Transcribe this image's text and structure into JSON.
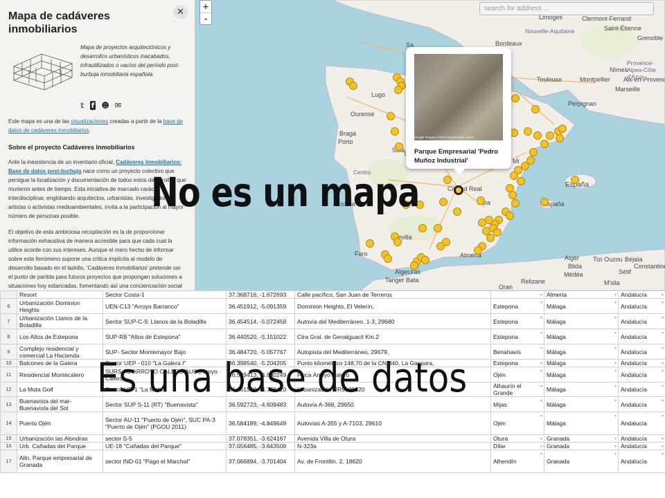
{
  "sidebar": {
    "title": "Mapa de cadáveres inmobiliarios",
    "close": "✕",
    "tagline": "Mapa de proyectos arquitectónicos y desarrollos urbanísticos inacabados, infrautilizados o vacíos del período post-burbuja inmobiliaria española.",
    "social_icons": [
      "twitter-icon",
      "facebook-icon",
      "github-icon",
      "mail-icon"
    ],
    "p1_a": "Este mapa es una de las ",
    "p1_link1": "visualizaciones",
    "p1_b": " creadas a partir de la ",
    "p1_link2": "base de datos de cadáveres inmobiliarios",
    "p1_c": ".",
    "section_title": "Sobre el proyecto Cadáveres Inmobiliarios",
    "p2_a": "Ante la inexistencia de un inventario oficial, ",
    "p2_link": "Cadáveres Inmobiliarios: Base de datos post-burbuja",
    "p2_b": " nace como un proyecto colectivo que persigue la localización y documentación de todos estos desarrollos que murieron antes de tiempo. Esta iniciativa de marcado carácter interdisciplinar, englobando arquitectos, urbanistas, investigadores, artistas o activistas medioambientales, invita a la participación al mayor número de personas posible.",
    "p3": "El objetivo de esta ambiciosa recopilación es la de proporcionar información exhaustiva de manera accesible para que cada cual la utilice acorde con sus intereses. Aunque el mero hecho de informar sobre este fenómeno supone una crítica implícita al modelo de desarrollo basado en el ladrillo, 'Cadáveres Inmobiliarios' pretende ser el punto de partida para futuros proyectos que propongan soluciones a situaciones hoy estancadas, fomentando así una concienciación social con respecto a una realidad que nos define y a"
  },
  "map": {
    "zoom_in": "+",
    "zoom_out": "-",
    "search_placeholder": "search for address ...",
    "popup_title": "Parque Empresarial 'Pedro Muñoz Industrial'",
    "popup_credit": "Google  Imagery ©2015 DigitalGlobe, Spain",
    "labels": {
      "nouvelle": "Nouvelle-Aquitaine",
      "bordeaux": "Bordeaux",
      "toulouse": "Toulouse",
      "montpellier": "Montpellier",
      "aixen": "Aix-en-Provence",
      "marseille": "Marseille",
      "provence": "Provence-Alpes-Côte d'Azur",
      "perpignan": "Perpignan",
      "limoges": "Limoges",
      "clermont": "Clermont-Ferrand",
      "sainteti": "Saint-Étienne",
      "grenoble": "Grenoble",
      "nimes": "Nîmes",
      "lugo": "Lugo",
      "ourense": "Ourense",
      "braga": "Braga",
      "porto": "Porto",
      "centro": "Centro",
      "lisboa": "Lisboa",
      "faro": "Faro",
      "sevilla": "Sevilla",
      "tangerb": "Tanger Bata",
      "tanger": "Tanger",
      "oran": "Oran",
      "alger": "Alger",
      "blida": "Blida",
      "medea": "Médéa",
      "tizi": "Tizi Ouzou",
      "bejaia": "Béjaïa",
      "setif": "Sétif",
      "constantine": "Constantine",
      "msila": "M'sila",
      "relizane": "Relizane",
      "algeciras": "Algeciras",
      "almeria": "Almería",
      "sala": "Sala",
      "espana1": "España",
      "espana2": "España",
      "alba": "Alba",
      "ciudad": "Ciudad Real",
      "sa": "Sa",
      "mi": "Mi"
    }
  },
  "overlays": {
    "map_caption": "No es un mapa",
    "table_caption": "Es una base de datos"
  },
  "table": {
    "rows": [
      {
        "num": "",
        "name": "Resort",
        "sector": "Sector Costa-1",
        "coords": "37.368716, -1.672693",
        "address": "Calle pacífico, San Juan de Terreros",
        "city": "",
        "prov": "Almería",
        "region": "Andalucía"
      },
      {
        "num": "6",
        "name": "Urbanización Dominion Heights",
        "sector": "UEN-C13 \"Arroyo Barranco\"",
        "coords": "36.451912, -5.091359",
        "address": "Dominion Heights, El Velerín,",
        "city": "Estepona",
        "prov": "Málaga",
        "region": "Andalucía"
      },
      {
        "num": "7",
        "name": "Urbanización Llanos de la Boladilla",
        "sector": "Sector SUP-C-9, Llanos de la Boladilla",
        "coords": "36.454514, -5.072458",
        "address": "Autovía del Mediterráneo, 1-3, 29680",
        "city": "Estepona",
        "prov": "Málaga",
        "region": "Andalucía"
      },
      {
        "num": "8",
        "name": "Los Altos de Estepona",
        "sector": "SUP-R8 \"Altos de Estepona\"",
        "coords": "36.440520, -5.151022",
        "address": "Ctra Gral. de Genalguacil Km.2",
        "city": "Estepona",
        "prov": "Málaga",
        "region": "Andalucía"
      },
      {
        "num": "9",
        "name": "Complejo residencial y comercial La Hacienda",
        "sector": "SUP- Sector Montemayor Bajo",
        "coords": "36.484720, -5.057767",
        "address": "Autopista del Mediterráneo, 29679,",
        "city": "Benahavís",
        "prov": "Málaga",
        "region": "Andalucía"
      },
      {
        "num": "10",
        "name": "Balcones de la Galera",
        "sector": "Sector UEP - 010 \"La Galera I\"",
        "coords": "36.398540, -5.204205",
        "address": "Punto kilométrico 148,70 de la CN-340, La Gaspara,",
        "city": "Estepona",
        "prov": "Málaga",
        "region": "Andalucía"
      },
      {
        "num": "11",
        "name": "Residencial Montecalero",
        "sector": "SURS-R2 ARROYO CALERO AU6 (Arroyo Calero)",
        "coords": "36.539413, -4.880249",
        "address": "Finca Arroyo Calero",
        "city": "Ojén",
        "prov": "Málaga",
        "region": "Andalucía"
      },
      {
        "num": "12",
        "name": "La Mota Golf",
        "sector": "Sector UR-1 \"La Mota\"",
        "coords": "36.661550, -4.778420",
        "address": "Urbanización UR9, 29120",
        "city": "Alhaurín el Grande",
        "prov": "Málaga",
        "region": "Andalucía"
      },
      {
        "num": "13",
        "name": "Buenavista del mar- Buenavista del Sol",
        "sector": "Sector SUP S-11 (RT) \"Buenavista\"",
        "coords": "36.592723, -4.609483",
        "address": "Autovía A-368, 29650",
        "city": "Mijas",
        "prov": "Málaga",
        "region": "Andalucía"
      },
      {
        "num": "14",
        "name": "Puerto Ojén",
        "sector": "Sector AU-11 \"Puerto de Ojén\", SUC PA-3 \"Puerto de Ojén\" (PGOU 2011)",
        "coords": "36.584189, -4.849649",
        "address": "Autovías A-355 y A-7103, 29610",
        "city": "Ojén",
        "prov": "Málaga",
        "region": "Andalucía"
      },
      {
        "num": "15",
        "name": "Urbanización las Alondras",
        "sector": "sector S-5",
        "coords": "37.078351, -3.624167",
        "address": "Avenida Villa de Otura",
        "city": "Otura",
        "prov": "Granada",
        "region": "Andalucía"
      },
      {
        "num": "16",
        "name": "Urb. Cañadas del Parque",
        "sector": "UE-18 \"Cañadas del Parque\"",
        "coords": "37.056485, -3.643509",
        "address": "N-323a",
        "city": "Dílar",
        "prov": "Granada",
        "region": "Andalucía"
      },
      {
        "num": "17",
        "name": "Alln. Parque empresarial de Granada",
        "sector": "sector IND-01 \"Pago el Marchal\"",
        "coords": "37.066894, -3.701404",
        "address": "Av. de Frontilin, 2. 18620",
        "city": "Alhendín",
        "prov": "Granada",
        "region": "Andalucía"
      }
    ]
  }
}
